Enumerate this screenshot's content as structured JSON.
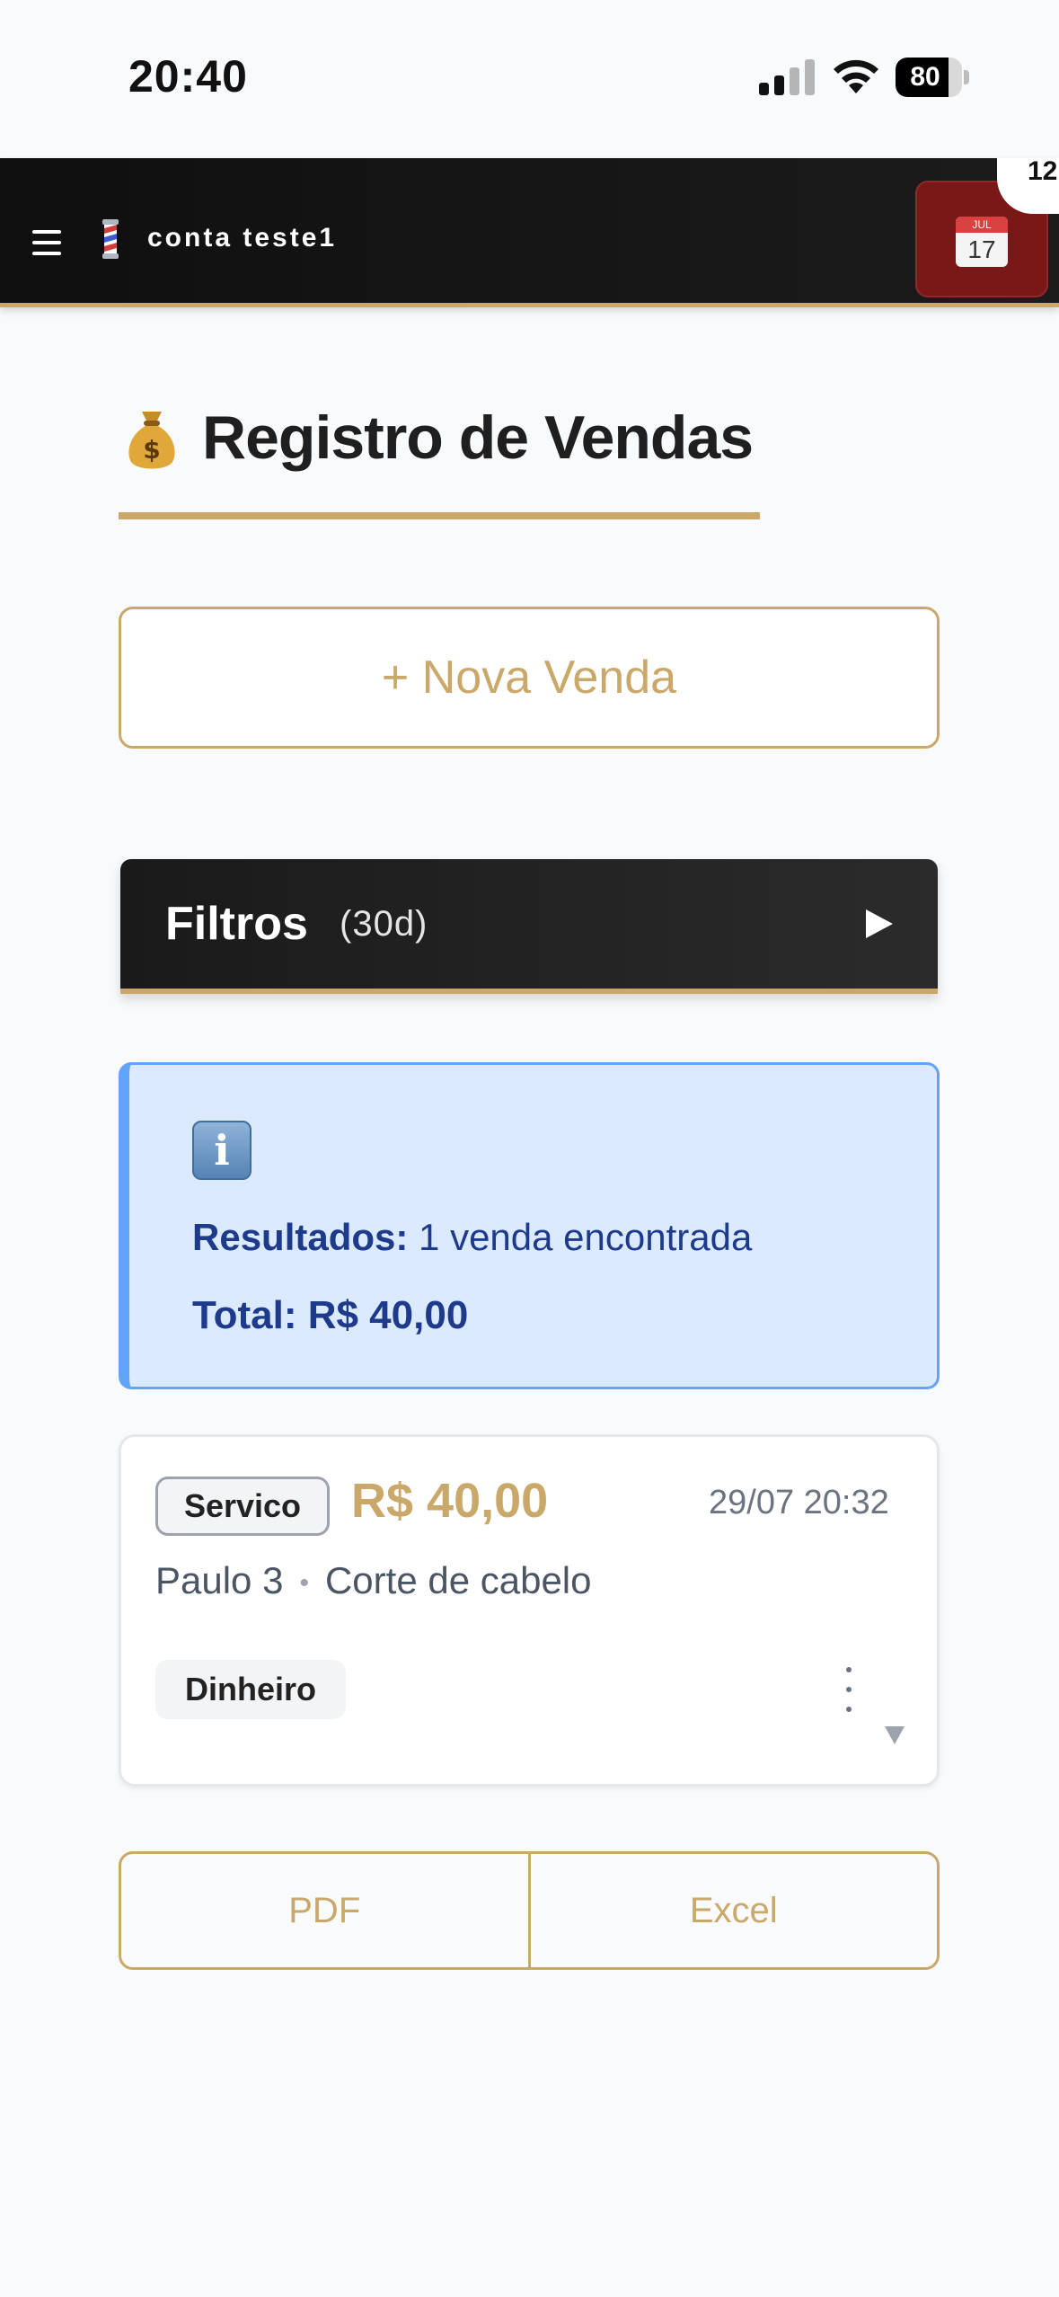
{
  "status_bar": {
    "time": "20:40",
    "battery": "80",
    "battery_level": 0.8
  },
  "header": {
    "account_name": "conta teste1",
    "calendar_month": "JUL",
    "calendar_day": "17",
    "badge": "12",
    "accent_color": "#c9a86a",
    "calendar_color": "#7a1717"
  },
  "page": {
    "title": "Registro de Vendas",
    "title_icon": "money-bag-icon"
  },
  "new_sale": {
    "label": "+ Nova Venda"
  },
  "filters": {
    "label": "Filtros",
    "period": "(30d)"
  },
  "results": {
    "label": "Resultados:",
    "text": "1 venda encontrada",
    "total": "Total: R$ 40,00",
    "icon": "info-icon"
  },
  "sales": [
    {
      "type": "Servico",
      "amount": "R$ 40,00",
      "date": "29/07 20:32",
      "client": "Paulo 3",
      "service": "Corte de cabelo",
      "payment": "Dinheiro"
    }
  ],
  "export": {
    "pdf": "PDF",
    "excel": "Excel"
  }
}
